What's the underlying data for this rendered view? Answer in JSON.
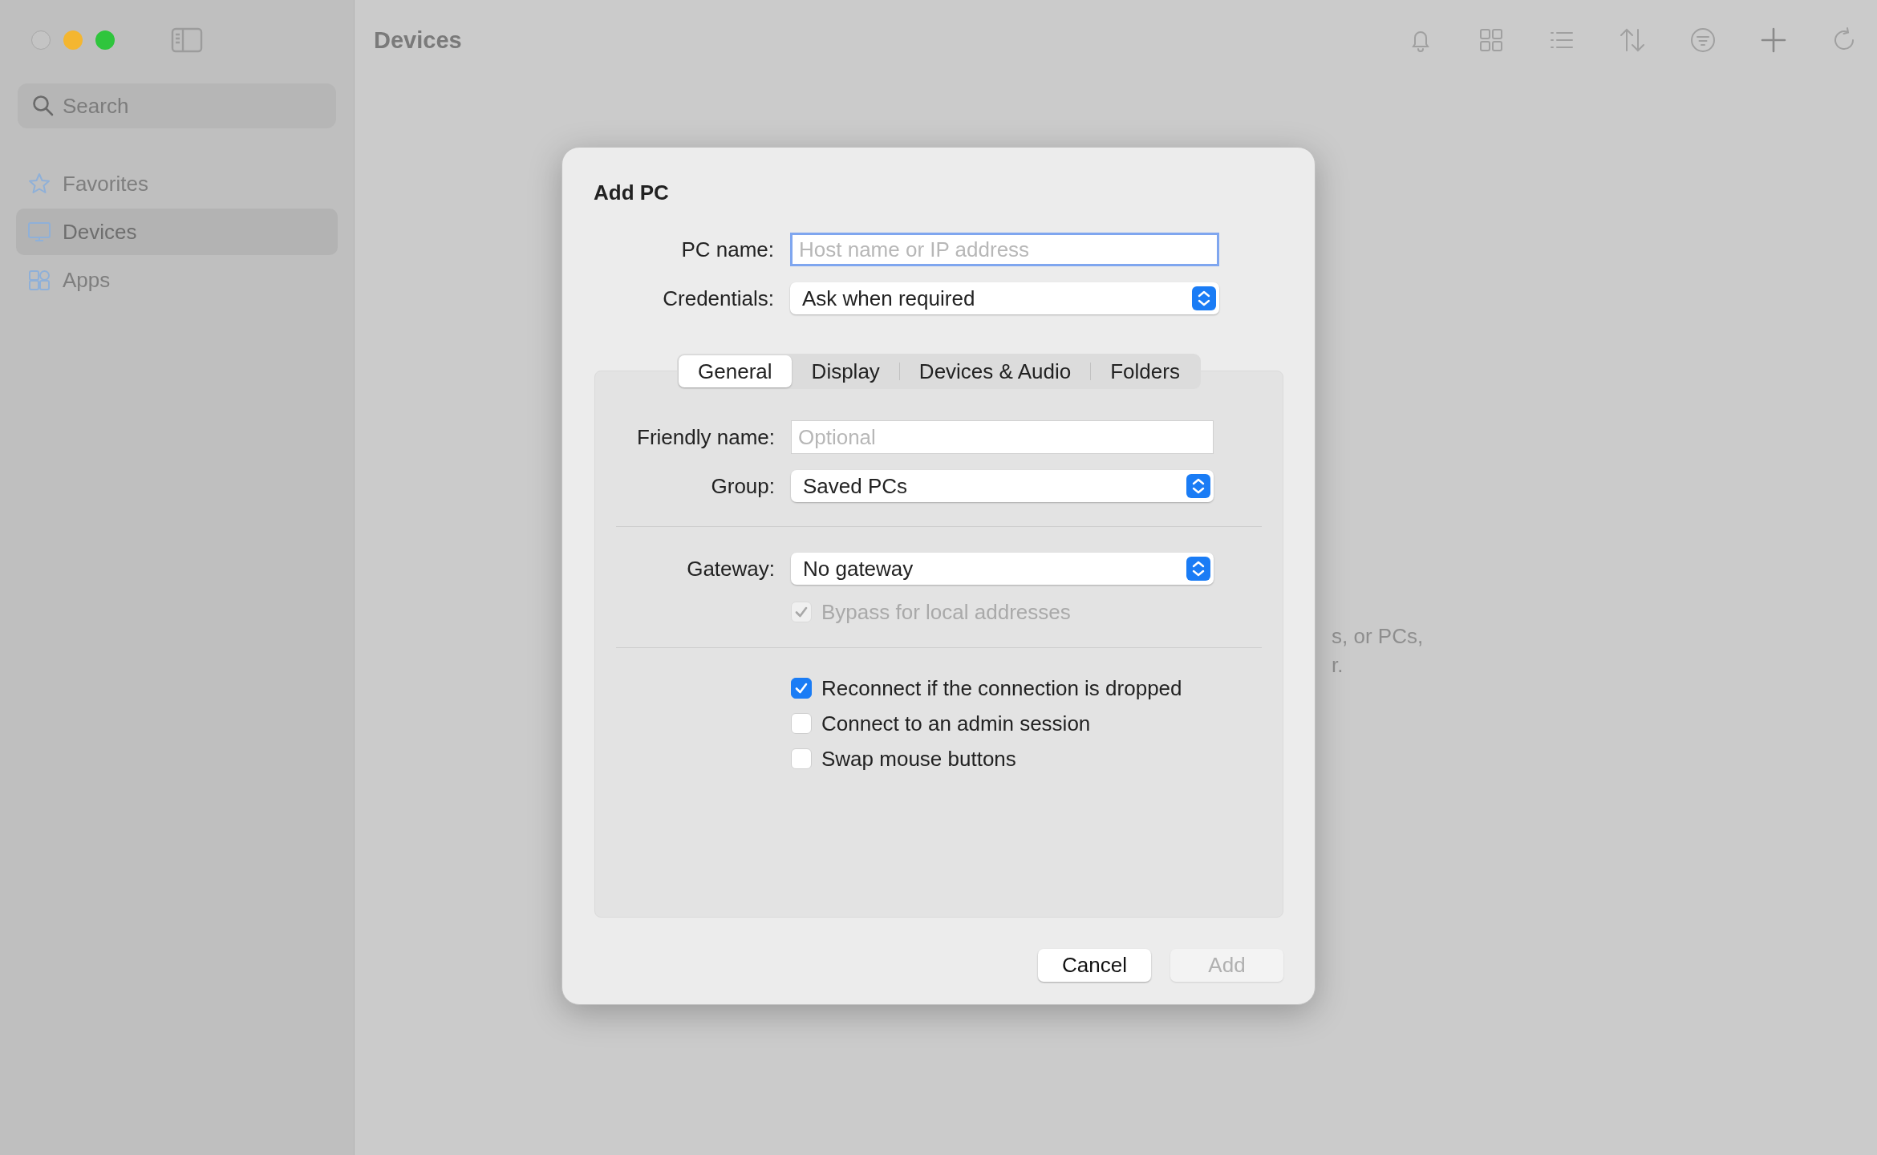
{
  "window": {
    "title": "Devices"
  },
  "sidebar": {
    "search": {
      "placeholder": "Search"
    },
    "items": [
      {
        "label": "Favorites",
        "selected": false
      },
      {
        "label": "Devices",
        "selected": true
      },
      {
        "label": "Apps",
        "selected": false
      }
    ]
  },
  "background_text": [
    "s, or PCs,",
    "r."
  ],
  "dialog": {
    "title": "Add PC",
    "fields": [
      {
        "label": "PC name:",
        "kind": "text",
        "placeholder": "Host name or IP address",
        "focused": true
      },
      {
        "label": "Credentials:",
        "kind": "popup",
        "value": "Ask when required"
      }
    ],
    "tabs": [
      {
        "label": "General",
        "selected": true
      },
      {
        "label": "Display",
        "selected": false
      },
      {
        "label": "Devices & Audio",
        "selected": false
      },
      {
        "label": "Folders",
        "selected": false
      }
    ],
    "general": {
      "fields": [
        {
          "label": "Friendly name:",
          "kind": "text",
          "placeholder": "Optional",
          "focused": false
        },
        {
          "label": "Group:",
          "kind": "popup",
          "value": "Saved PCs"
        }
      ],
      "gateway": {
        "label": "Gateway:",
        "kind": "popup",
        "value": "No gateway"
      },
      "bypass": {
        "label": "Bypass for local addresses",
        "checked": true,
        "disabled": true
      },
      "options": [
        {
          "label": "Reconnect if the connection is dropped",
          "checked": true,
          "disabled": false
        },
        {
          "label": "Connect to an admin session",
          "checked": false,
          "disabled": false
        },
        {
          "label": "Swap mouse buttons",
          "checked": false,
          "disabled": false
        }
      ]
    },
    "buttons": [
      {
        "label": "Cancel",
        "disabled": false
      },
      {
        "label": "Add",
        "disabled": true
      }
    ]
  }
}
